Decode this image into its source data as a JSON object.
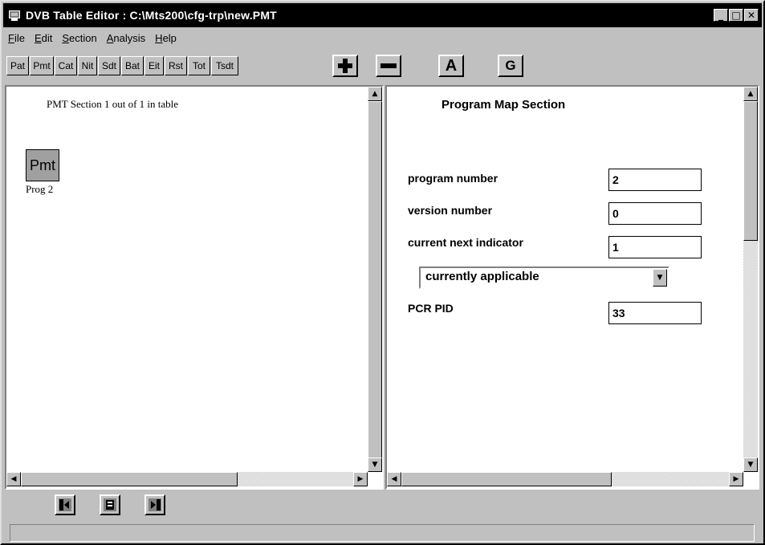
{
  "window": {
    "title": "DVB Table Editor : C:\\Mts200\\cfg-trp\\new.PMT",
    "controls": {
      "minimize": "_",
      "maximize": "□",
      "close": "✕"
    }
  },
  "menu": [
    "File",
    "Edit",
    "Section",
    "Analysis",
    "Help"
  ],
  "toolbar": {
    "tables": [
      "Pat",
      "Pmt",
      "Cat",
      "Nit",
      "Sdt",
      "Bat",
      "Eit",
      "Rst",
      "Tot",
      "Tsdt"
    ],
    "add_label": "+",
    "remove_label": "−",
    "a_label": "A",
    "g_label": "G"
  },
  "left_pane": {
    "section_title": "PMT Section 1 out of 1 in table",
    "block_label": "Pmt",
    "prog_label": "Prog 2"
  },
  "right_pane": {
    "title": "Program Map Section",
    "fields": [
      {
        "label": "program number",
        "value": "2"
      },
      {
        "label": "version number",
        "value": "0"
      },
      {
        "label": "current next indicator",
        "value": "1"
      }
    ],
    "dropdown_value": "currently applicable",
    "pcr_label": "PCR PID",
    "pcr_value": "33"
  },
  "scroll": {
    "up": "▲",
    "down": "▼",
    "left": "◀",
    "right": "▶"
  },
  "icons": [
    "app-icon",
    "previous-section-icon",
    "section-info-icon",
    "next-section-icon",
    "dropdown-arrow-icon"
  ]
}
